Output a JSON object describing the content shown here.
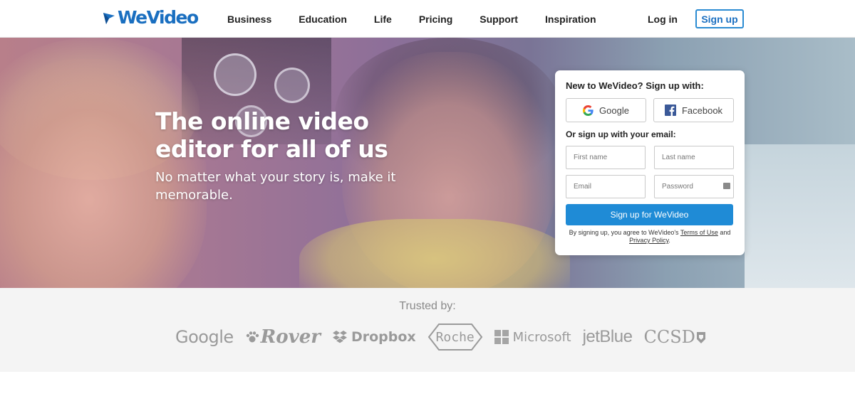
{
  "header": {
    "logo_text": "WeVideo",
    "nav": [
      "Business",
      "Education",
      "Life",
      "Pricing",
      "Support",
      "Inspiration"
    ],
    "login_label": "Log in",
    "signup_label": "Sign up"
  },
  "hero": {
    "title": "The online video editor for all of us",
    "subtitle": "No matter what your story is, make it memorable."
  },
  "signup_card": {
    "title": "New to WeVideo? Sign up with:",
    "google_label": "Google",
    "facebook_label": "Facebook",
    "email_title": "Or sign up with your email:",
    "first_name_placeholder": "First name",
    "last_name_placeholder": "Last name",
    "email_placeholder": "Email",
    "password_placeholder": "Password",
    "submit_label": "Sign up for WeVideo",
    "terms_prefix": "By signing up, you agree to WeVideo's ",
    "terms_link": "Terms of Use",
    "terms_middle": " and",
    "privacy_link": "Privacy Policy",
    "terms_suffix": "."
  },
  "trusted": {
    "title": "Trusted by:",
    "brands": [
      "Google",
      "Rover",
      "Dropbox",
      "Roche",
      "Microsoft",
      "jetBlue",
      "CCSD"
    ]
  },
  "colors": {
    "brand_blue": "#1a6fc0",
    "button_blue": "#1f8bd6",
    "trusted_bg": "#f4f4f4",
    "logo_gray": "#9a9a9a"
  },
  "icons": [
    "wevideo-logo-icon",
    "google-icon",
    "facebook-icon",
    "password-manager-icon",
    "rover-paw-icon",
    "dropbox-icon",
    "microsoft-icon",
    "ccsd-flag-icon"
  ]
}
